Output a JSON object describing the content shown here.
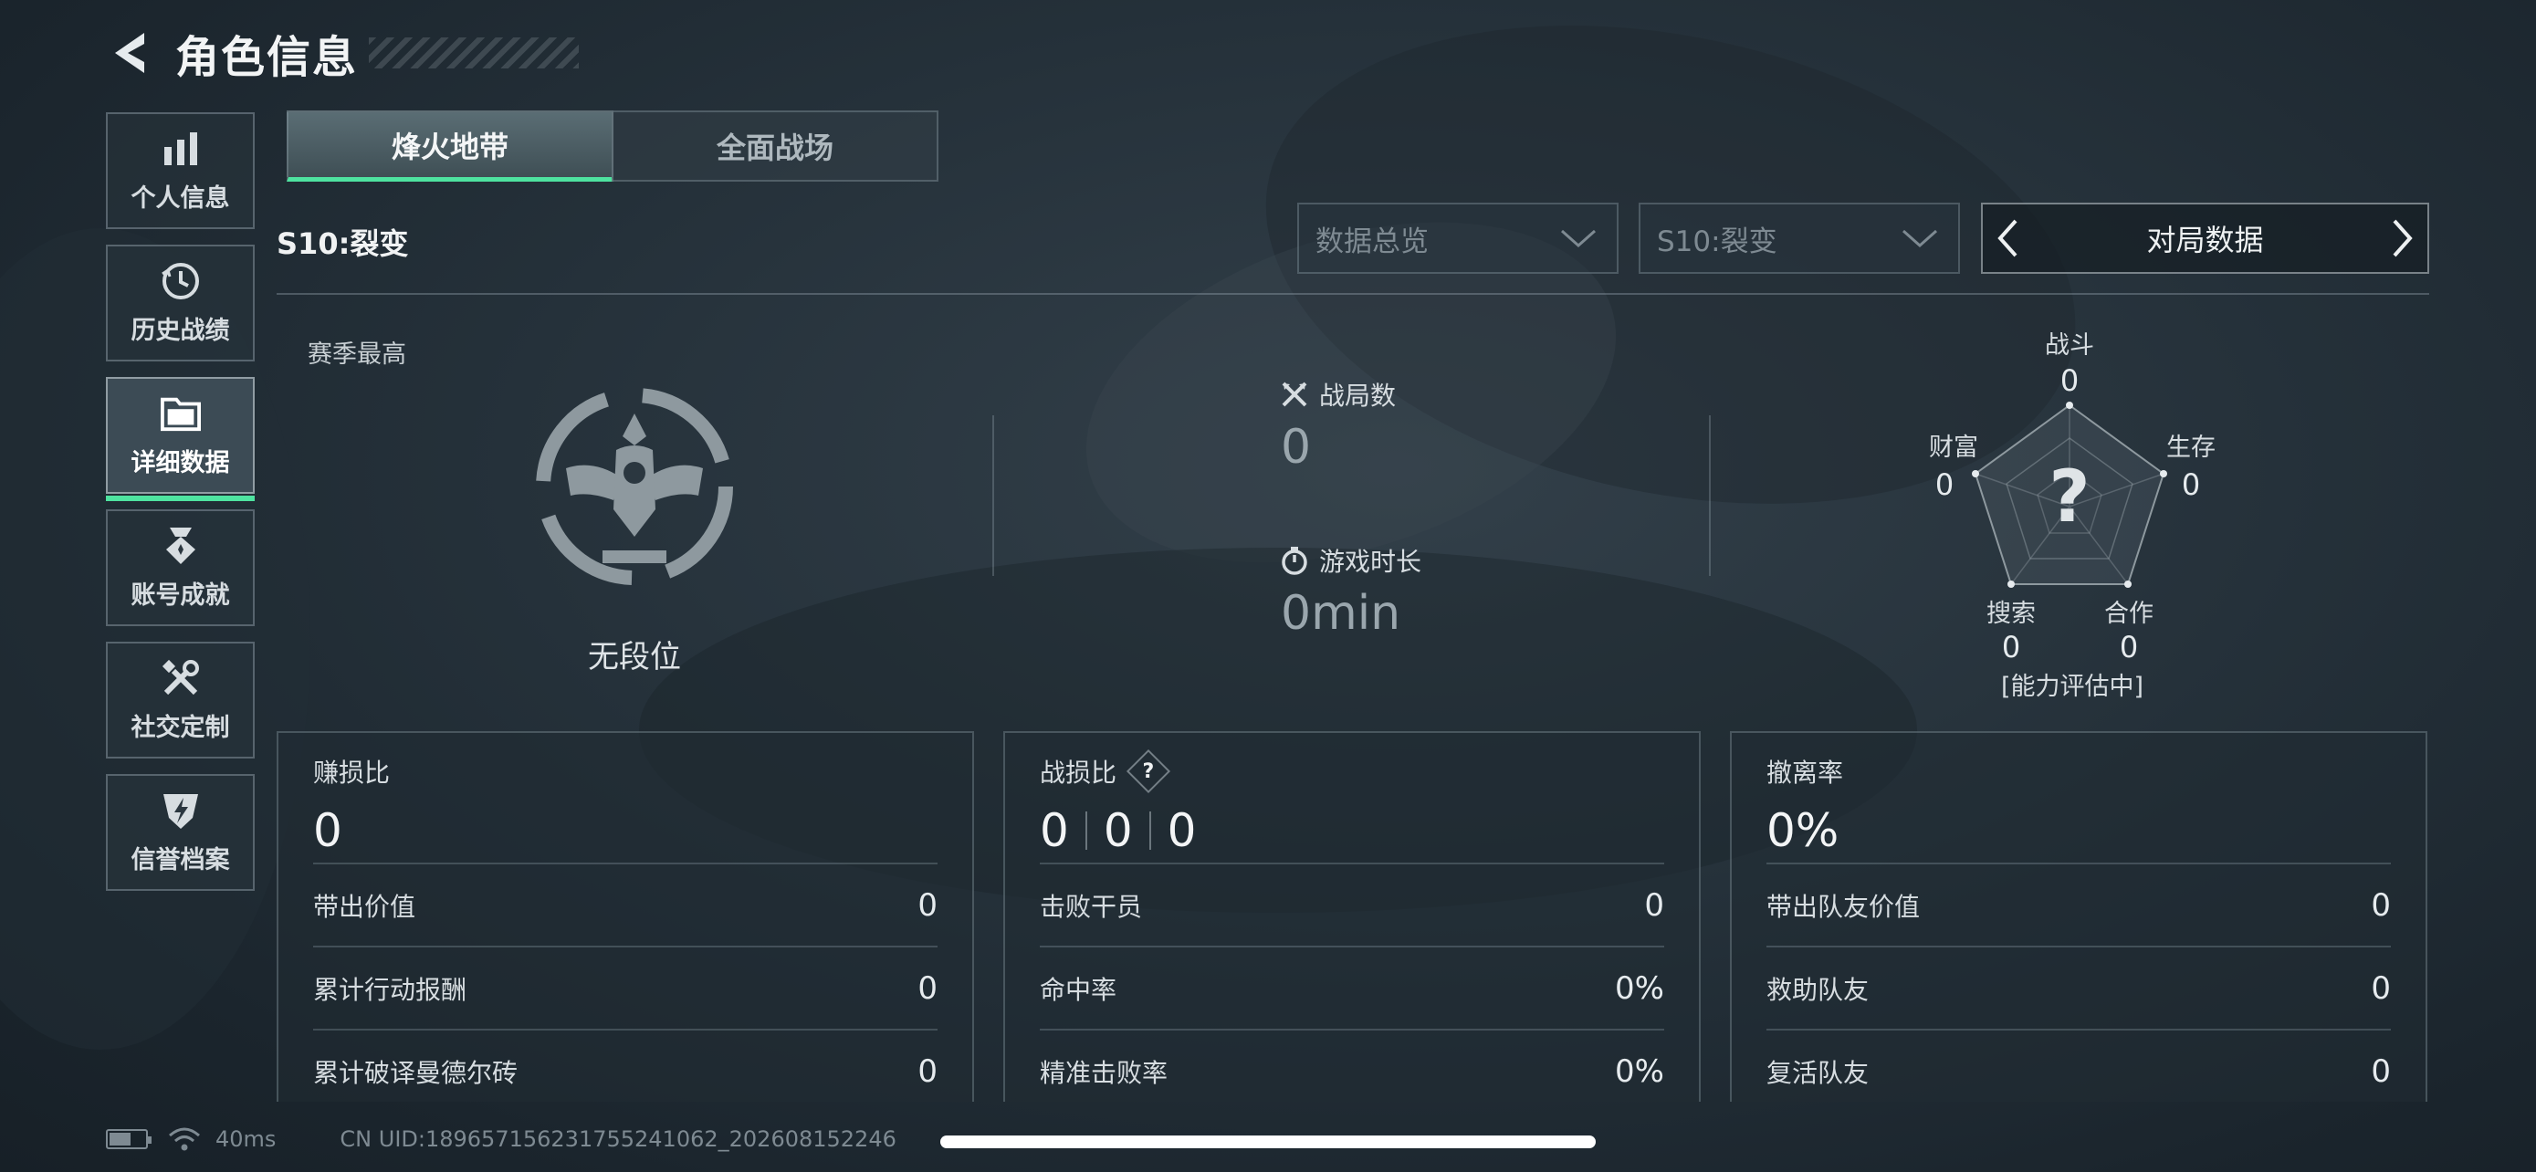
{
  "header": {
    "title": "角色信息"
  },
  "sidebar": {
    "items": [
      {
        "label": "个人信息",
        "icon": "bar-chart-icon"
      },
      {
        "label": "历史战绩",
        "icon": "history-clock-icon"
      },
      {
        "label": "详细数据",
        "icon": "folder-icon",
        "active": true
      },
      {
        "label": "账号成就",
        "icon": "medal-icon"
      },
      {
        "label": "社交定制",
        "icon": "tools-icon"
      },
      {
        "label": "信誉档案",
        "icon": "shield-lightning-icon"
      }
    ]
  },
  "tabs": [
    {
      "label": "烽火地带",
      "active": true
    },
    {
      "label": "全面战场",
      "active": false
    }
  ],
  "season_title": "S10:裂变",
  "filters": {
    "data_type": "数据总览",
    "season": "S10:裂变",
    "switcher_label": "对局数据"
  },
  "summary": {
    "rank_caption": "赛季最高",
    "rank_label": "无段位",
    "matches_label": "战局数",
    "matches_value": "0",
    "playtime_label": "游戏时长",
    "playtime_value": "0min"
  },
  "radar": {
    "center_mark": "?",
    "status": "[能力评估中]",
    "axes": [
      {
        "label": "战斗",
        "value": "0"
      },
      {
        "label": "生存",
        "value": "0"
      },
      {
        "label": "合作",
        "value": "0"
      },
      {
        "label": "搜索",
        "value": "0"
      },
      {
        "label": "财富",
        "value": "0"
      }
    ]
  },
  "cards": [
    {
      "head": "赚损比",
      "main": "0",
      "rows": [
        {
          "label": "带出价值",
          "value": "0"
        },
        {
          "label": "累计行动报酬",
          "value": "0"
        },
        {
          "label": "累计破译曼德尔砖",
          "value": "0"
        }
      ]
    },
    {
      "head": "战损比",
      "badge": "?",
      "main_parts": [
        "0",
        "0",
        "0"
      ],
      "rows": [
        {
          "label": "击败干员",
          "value": "0"
        },
        {
          "label": "命中率",
          "value": "0%"
        },
        {
          "label": "精准击败率",
          "value": "0%"
        }
      ]
    },
    {
      "head": "撤离率",
      "main": "0%",
      "rows": [
        {
          "label": "带出队友价值",
          "value": "0"
        },
        {
          "label": "救助队友",
          "value": "0"
        },
        {
          "label": "复活队友",
          "value": "0"
        }
      ]
    }
  ],
  "footer": {
    "ping": "40ms",
    "uid": "CN UID:18965715623175524106‌2_202608152246"
  },
  "colors": {
    "accent": "#4ee3a0",
    "background": "#25313a"
  }
}
